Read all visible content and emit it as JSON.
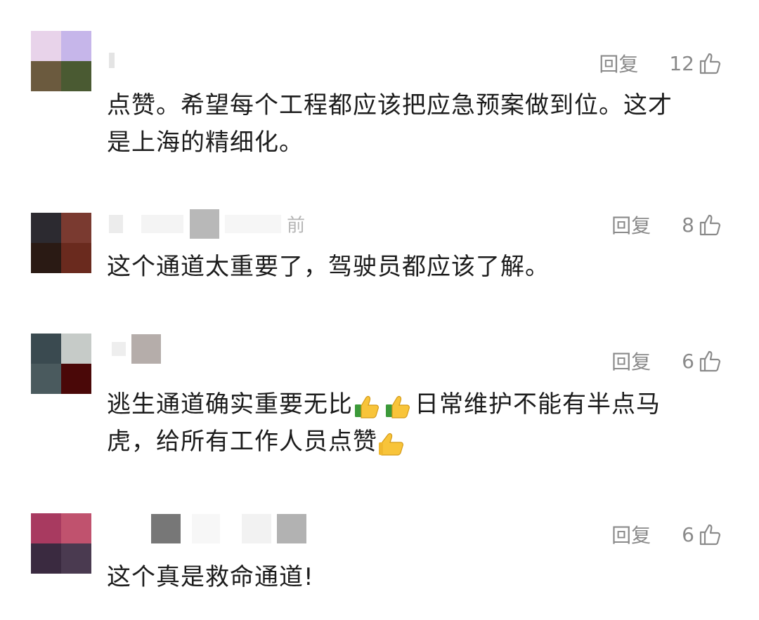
{
  "reply_label": "回复",
  "comments": [
    {
      "username": "",
      "time": "",
      "likes": "12",
      "text_lines": [
        "点赞。希望每个工程都应该把应急预案做到位。这才",
        "是上海的精细化。"
      ],
      "avatar_colors": [
        "#e8d3ea",
        "#c6b6ea",
        "#6b5a3e",
        "#4a5a32"
      ]
    },
    {
      "username": "",
      "time": "前",
      "likes": "8",
      "text_lines": [
        "这个通道太重要了，驾驶员都应该了解。"
      ],
      "avatar_colors": [
        "#2c2a30",
        "#7a3a30",
        "#2a1a14",
        "#6a2a1e"
      ]
    },
    {
      "username": "",
      "time": "",
      "likes": "6",
      "text_lines": [
        "逃生通道确实重要无比",
        "日常维护不能有半点马",
        "虎，给所有工作人员点赞"
      ],
      "avatar_colors": [
        "#3a4a50",
        "#c6cbc8",
        "#4a5a5e",
        "#4a0808"
      ]
    },
    {
      "username": "",
      "time": "",
      "likes": "6",
      "text_lines": [
        "这个真是救命通道!"
      ],
      "avatar_colors": [
        "#a83a60",
        "#c0526e",
        "#3a2a40",
        "#4a3a50"
      ]
    }
  ],
  "icons": {
    "like": "thumbs-up-outline-icon",
    "emoji": "thumbs-up-emoji-icon"
  }
}
